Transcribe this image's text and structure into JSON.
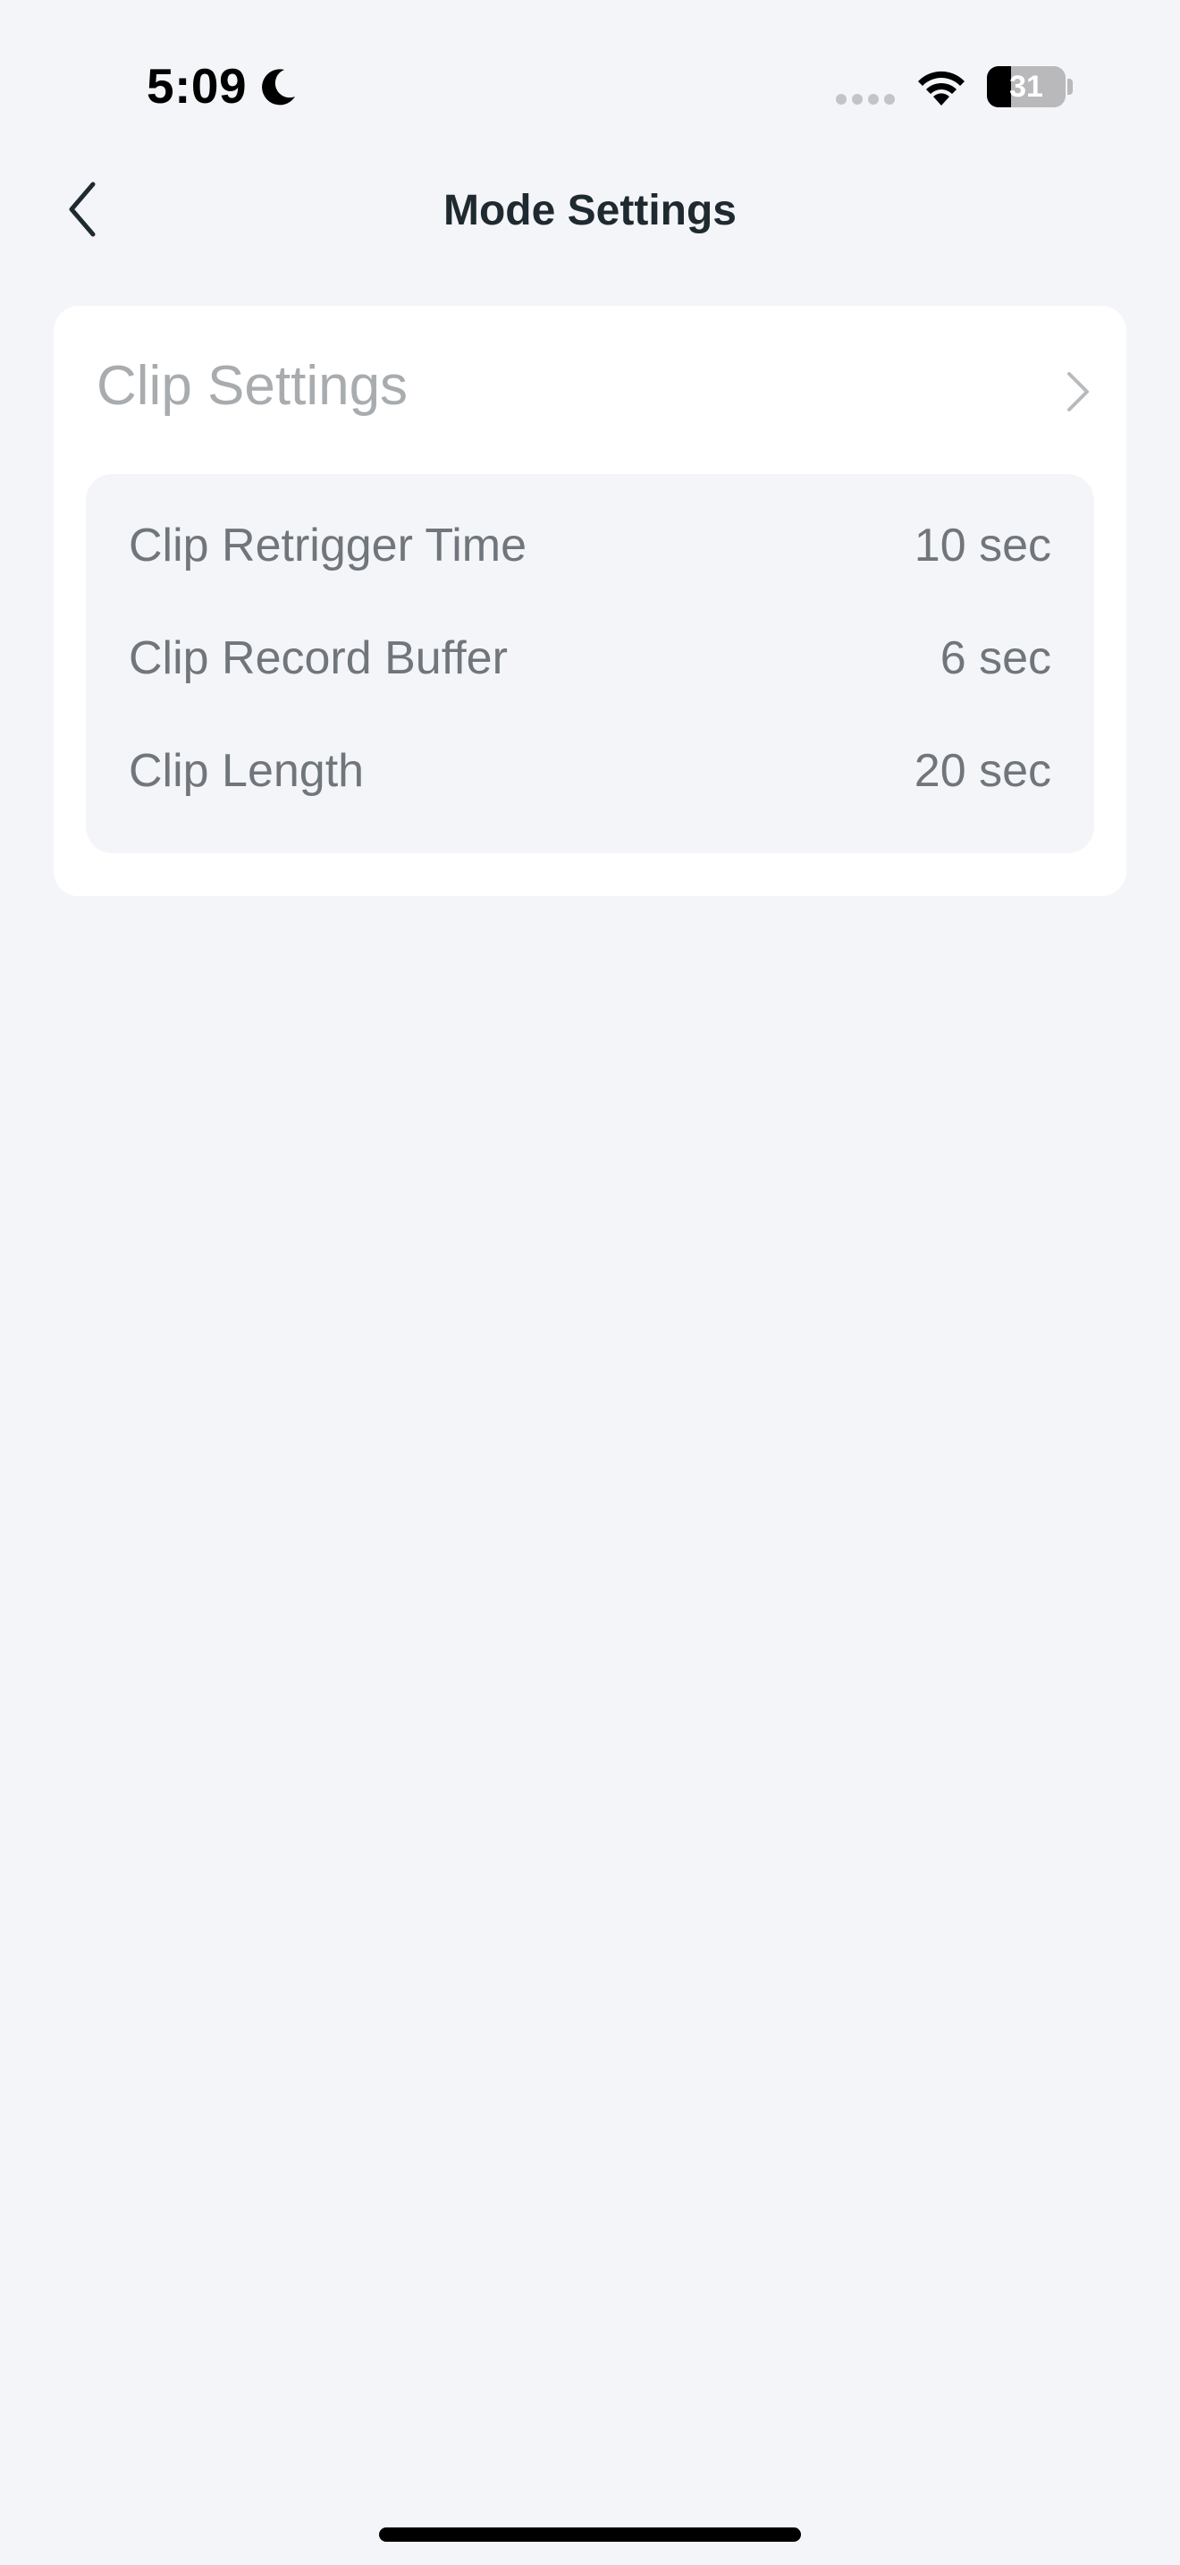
{
  "status_bar": {
    "time": "5:09",
    "battery_level": "31",
    "battery_fraction": 0.31,
    "icons": [
      "moon-icon",
      "signal-icon",
      "wifi-icon",
      "battery-icon"
    ]
  },
  "nav": {
    "title": "Mode Settings",
    "back_icon": "chevron-left-icon"
  },
  "clip_settings": {
    "title": "Clip Settings",
    "chevron_icon": "chevron-right-icon",
    "rows": [
      {
        "label": "Clip Retrigger Time",
        "value": "10 sec"
      },
      {
        "label": "Clip Record Buffer",
        "value": "6 sec"
      },
      {
        "label": "Clip Length",
        "value": "20 sec"
      }
    ]
  },
  "colors": {
    "background": "#f4f5f9",
    "card": "#ffffff",
    "title_text": "#1f2a30",
    "muted_text": "#70767b",
    "disabled_text": "#a8acaf"
  }
}
